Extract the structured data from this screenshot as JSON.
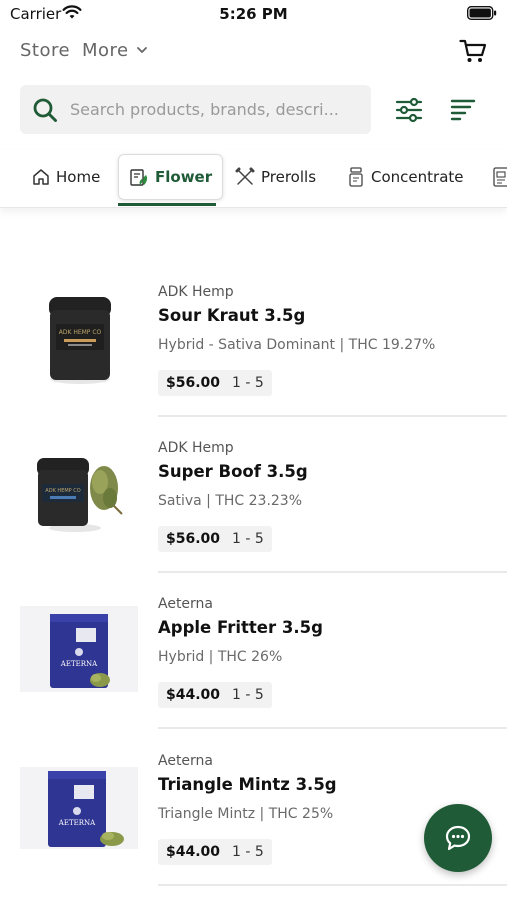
{
  "status_bar": {
    "carrier": "Carrier",
    "time": "5:26 PM"
  },
  "header": {
    "store_label": "Store",
    "more_label": "More",
    "icons": [
      "chevron-down-icon",
      "cart-icon"
    ]
  },
  "search": {
    "placeholder": "Search products, brands, descri...",
    "value": "",
    "icons": [
      "search-icon",
      "filter-icon",
      "sort-icon"
    ]
  },
  "categories": {
    "active": "Flower",
    "tabs": [
      {
        "label": "Home",
        "icon": "home-icon"
      },
      {
        "label": "Flower",
        "icon": "flower-icon"
      },
      {
        "label": "Prerolls",
        "icon": "preroll-icon"
      },
      {
        "label": "Concentrate",
        "icon": "concentrate-icon"
      },
      {
        "label": "",
        "icon": "edible-icon"
      }
    ]
  },
  "products": [
    {
      "brand": "ADK Hemp",
      "name": "Sour Kraut 3.5g",
      "description": "Hybrid - Sativa Dominant | THC 19.27%",
      "price": "$56.00",
      "quantity": "1 - 5",
      "image": "jar-image"
    },
    {
      "brand": "ADK Hemp",
      "name": "Super Boof 3.5g",
      "description": "Sativa | THC 23.23%",
      "price": "$56.00",
      "quantity": "1 - 5",
      "image": "jar-with-bud-image"
    },
    {
      "brand": "Aeterna",
      "name": "Apple Fritter 3.5g",
      "description": "Hybrid | THC 26%",
      "price": "$44.00",
      "quantity": "1 - 5",
      "image": "pouch-image"
    },
    {
      "brand": "Aeterna",
      "name": "Triangle Mintz 3.5g",
      "description": "Triangle Mintz | THC 25%",
      "price": "$44.00",
      "quantity": "1 - 5",
      "image": "pouch-image"
    }
  ],
  "product_image_labels": {
    "jar_label": "ADK HEMP CO",
    "pouch_label": "AETERNA"
  },
  "chat": {
    "icon": "chat-bubble-icon"
  },
  "colors": {
    "accent": "#1f5b37",
    "search_bg": "#f0f1f0",
    "price_pill_bg": "#f2f2f2"
  }
}
